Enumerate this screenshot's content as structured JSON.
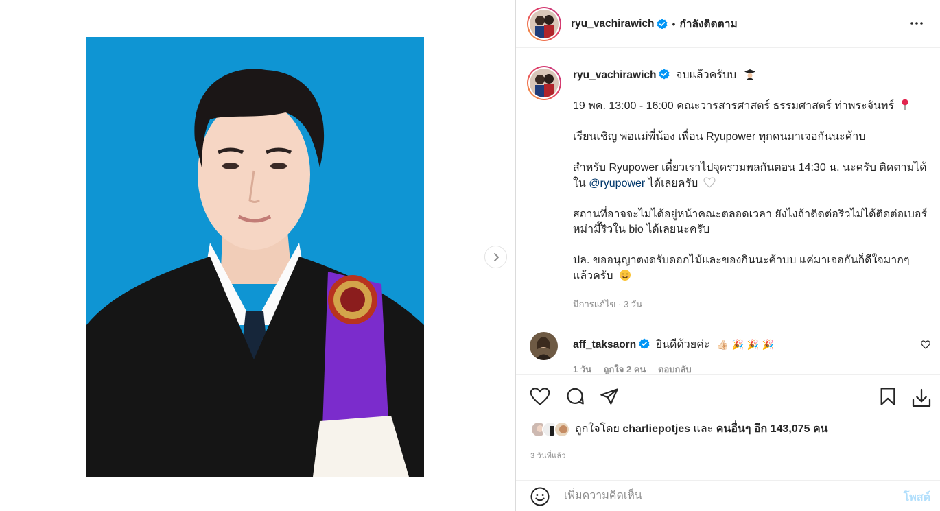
{
  "post": {
    "author": "ryu_vachirawich",
    "follow_state": "กำลังติดตาม",
    "separator": "•",
    "caption_first": "จบแล้วครับบ",
    "caption_lines": [
      "19 พค. 13:00 - 16:00 คณะวารสารศาสตร์ ธรรมศาสตร์ ท่าพระจันทร์",
      "เรียนเชิญ พ่อแม่พี่น้อง เพื่อน Ryupower ทุกคนมาเจอกันนะค้าบ",
      "สำหรับ Ryupower เดี๋ยวเราไปจุดรวมพลกันตอน 14:30 น. นะครับ ติดตามได้ใน",
      "@ryupower",
      "ได้เลยครับ",
      "สถานที่อาจจะไม่ได้อยู่หน้าคณะตลอดเวลา ยังไงถ้าติดต่อริวไม่ได้ติดต่อเบอร์หม่ามี๊ริวใน bio ได้เลยนะครับ",
      "ปล. ขออนุญาตงดรับดอกไม้และของกินนะค้าบบ แค่มาเจอกันก็ดีใจมากๆ แล้วครับ"
    ],
    "edited_meta": "มีการแก้ไข · 3 วัน",
    "icons": {
      "grad": "graduate-emoji",
      "pin": "pushpin-emoji",
      "heart": "white-heart-emoji",
      "smile": "smiling-face-emoji"
    }
  },
  "comment": {
    "author": "aff_taksaorn",
    "text": "ยินดีด้วยค่ะ",
    "emojis": "👍🏻 🎉 🎉 🎉",
    "meta": [
      "1 วัน",
      "ถูกใจ 2 คน",
      "ตอบกลับ"
    ]
  },
  "likes": {
    "prefix": "ถูกใจโดย",
    "user": "charliepotjes",
    "joiner": "และ",
    "others": "คนอื่นๆ อีก 143,075 คน"
  },
  "date": "3 วันที่แล้ว",
  "composer": {
    "placeholder": "เพิ่มความคิดเห็น",
    "post_label": "โพสต์"
  },
  "colors": {
    "verified": "#0095f6",
    "photo_bg": "#1296d4",
    "sash": "#7b2ccc"
  }
}
